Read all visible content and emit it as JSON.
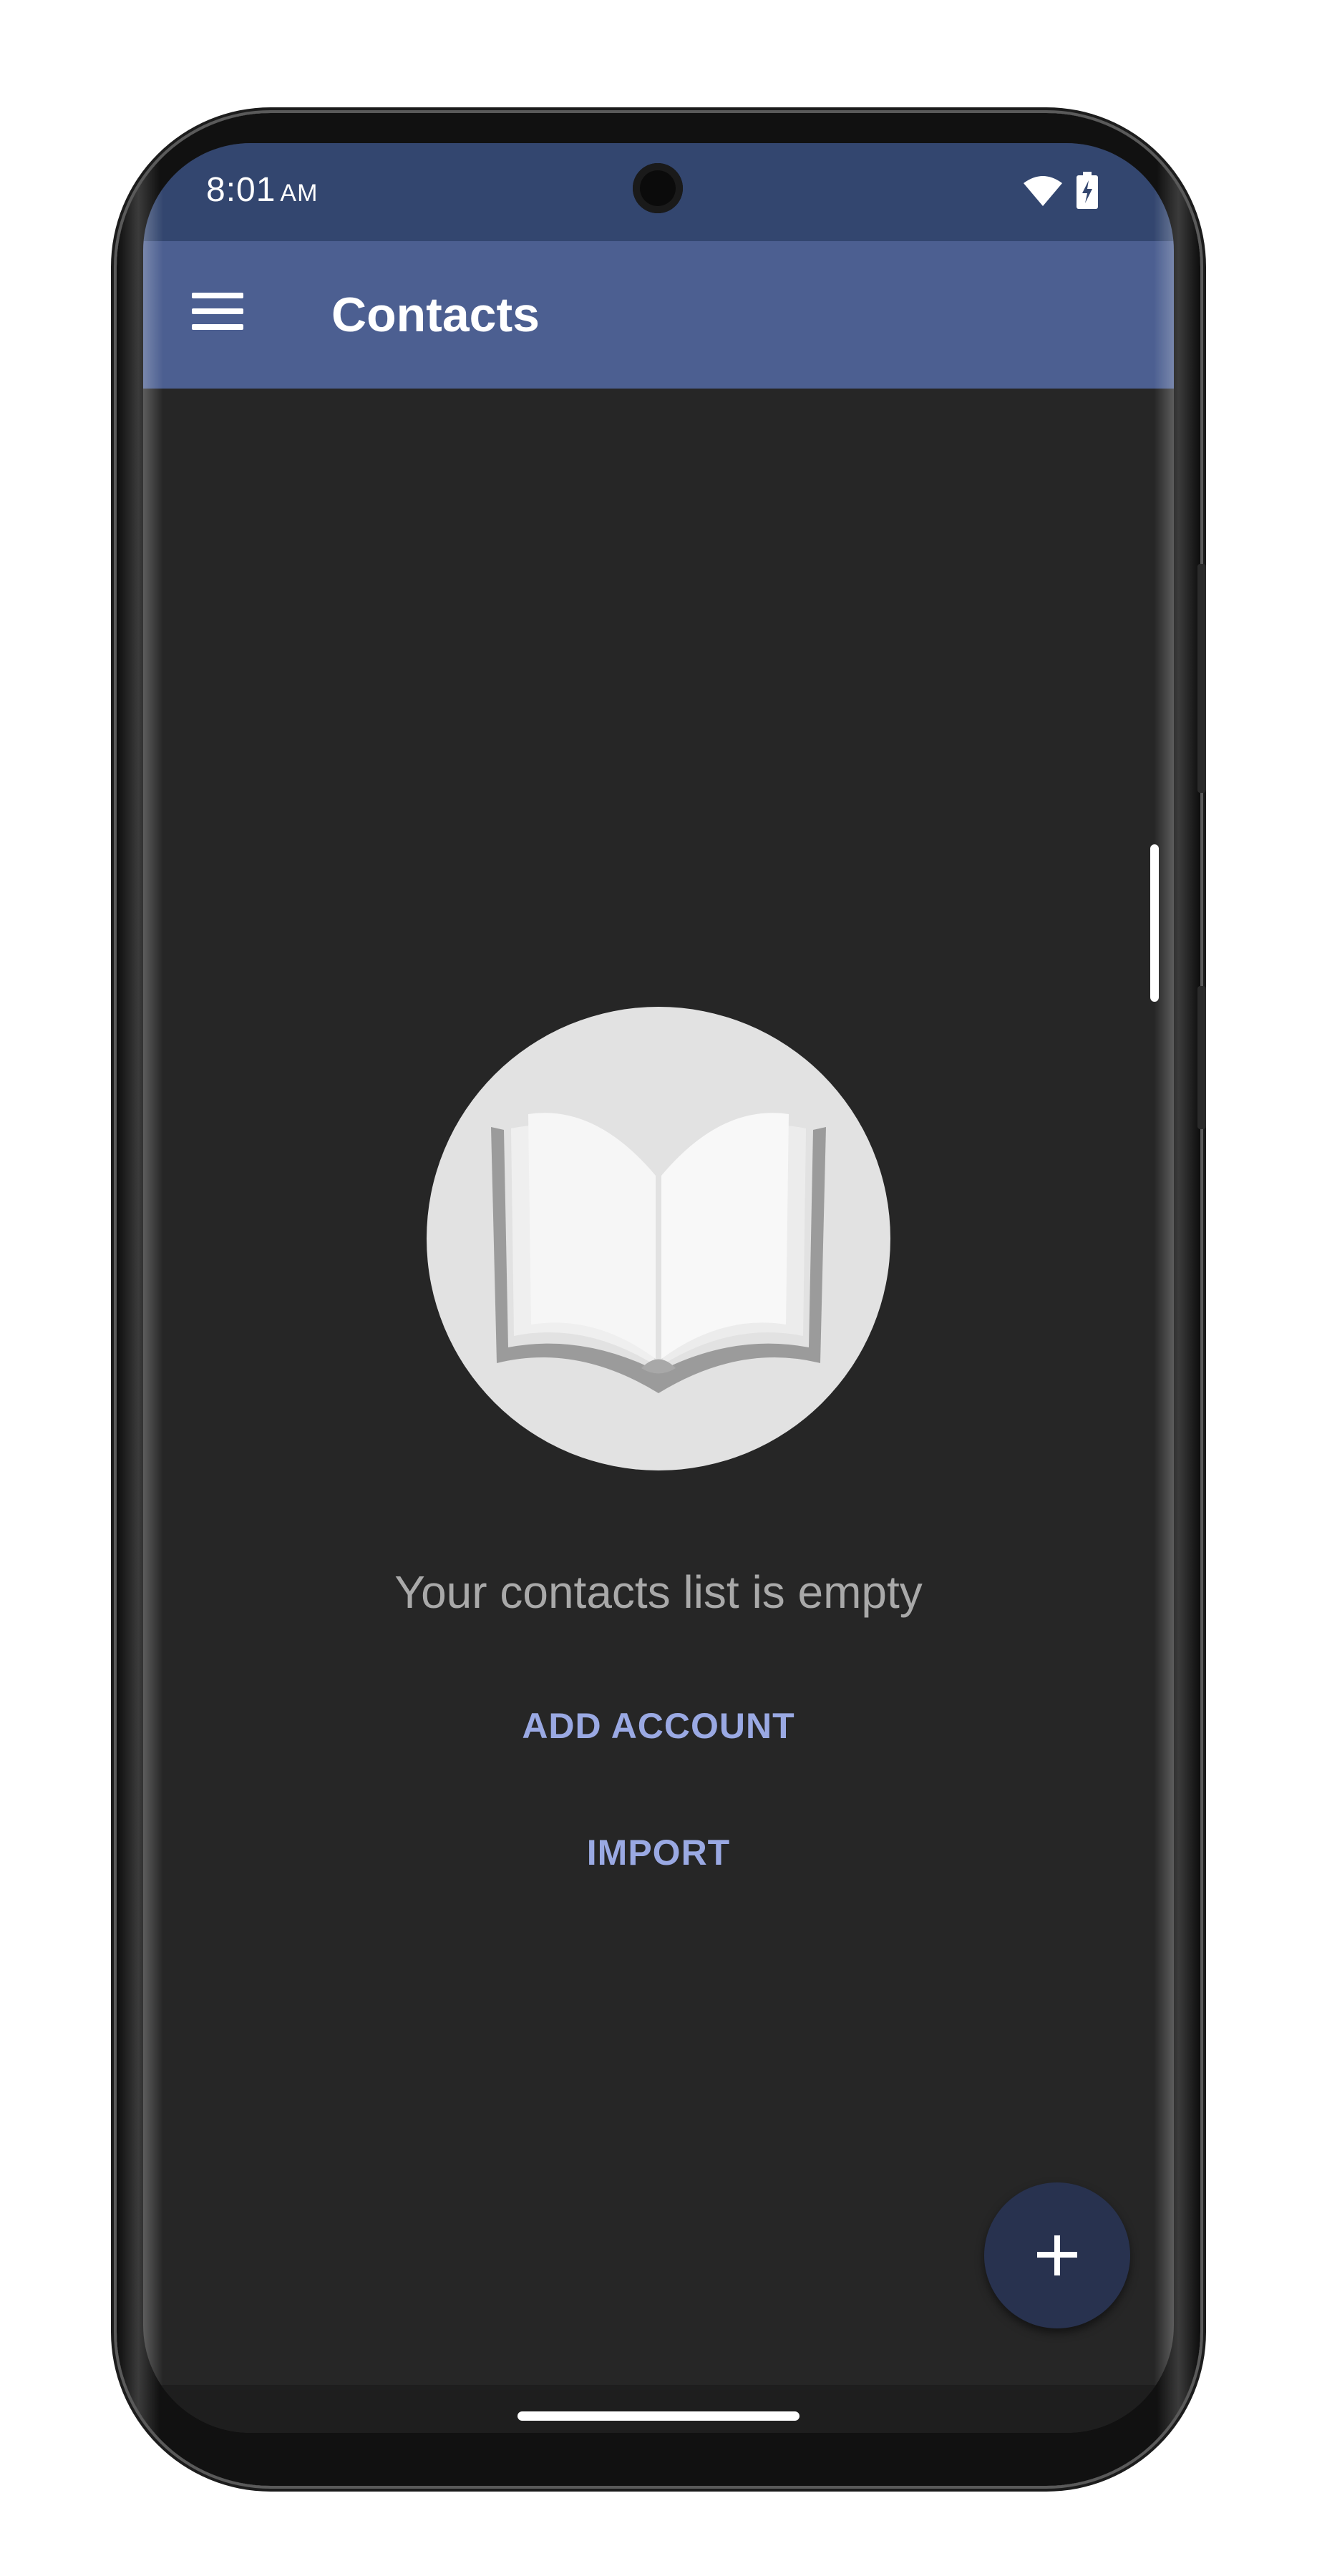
{
  "status_bar": {
    "time": "8:01",
    "ampm": "AM",
    "icons": [
      "wifi-icon",
      "battery-charging-icon"
    ]
  },
  "app_bar": {
    "menu_icon": "hamburger-menu-icon",
    "title": "Contacts"
  },
  "empty_state": {
    "illustration": "open-book-icon",
    "message": "Your contacts list is empty",
    "add_account_label": "ADD ACCOUNT",
    "import_label": "IMPORT"
  },
  "fab": {
    "icon": "plus-icon"
  },
  "colors": {
    "status_bar": "#33466f",
    "app_bar": "#4c5f91",
    "background": "#262626",
    "accent_text": "#9aa9e3",
    "fab": "#28324f"
  }
}
